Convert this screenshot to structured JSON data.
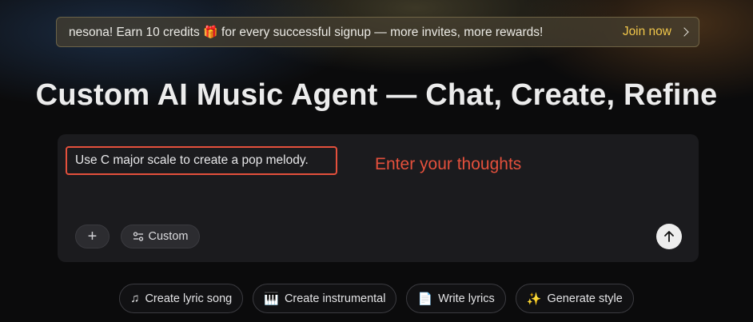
{
  "promo": {
    "text": "nesona! Earn 10 credits ",
    "gift_glyph": "🎁",
    "text_after": " for every successful signup — more invites, more rewards!",
    "join_label": "Join now"
  },
  "headline": "Custom AI Music Agent — Chat, Create, Refine",
  "composer": {
    "prompt_value": "Use C major scale to create a pop melody.",
    "annotation": "Enter your thoughts",
    "plus_label": "+",
    "custom_label": "Custom"
  },
  "chips": [
    {
      "icon": "♫",
      "icon_name": "music-note-icon",
      "label": "Create lyric song"
    },
    {
      "icon": "🎹",
      "icon_name": "piano-keys-icon",
      "label": "Create instrumental"
    },
    {
      "icon": "📄",
      "icon_name": "document-icon",
      "label": "Write lyrics"
    },
    {
      "icon": "✨",
      "icon_name": "sparkles-icon",
      "label": "Generate style"
    }
  ],
  "colors": {
    "accent_gold": "#f0c64a",
    "annotation_red": "#e4503c",
    "background": "#0b0b0c",
    "panel": "#1b1b1e"
  }
}
